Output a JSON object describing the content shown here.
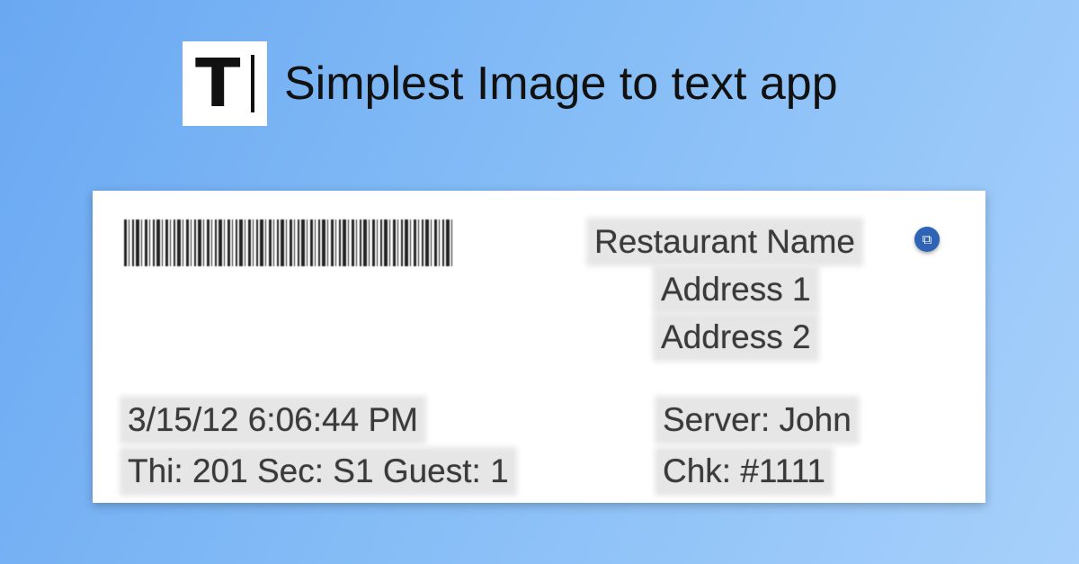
{
  "header": {
    "logo_letter": "T",
    "title": "Simplest Image to text app"
  },
  "receipt": {
    "restaurant_name": "Restaurant Name",
    "address_1": "Address 1",
    "address_2": "Address 2",
    "datetime": "3/15/12 6:06:44 PM",
    "table_info": "Thi: 201 Sec: S1 Guest: 1",
    "server": "Server: John",
    "check": "Chk: #1111"
  },
  "icons": {
    "copy": "copy-icon",
    "copy_glyph": "⧉"
  },
  "colors": {
    "background_start": "#6aa8f2",
    "background_end": "#a7d0fb",
    "copy_button": "#2f63b5"
  }
}
